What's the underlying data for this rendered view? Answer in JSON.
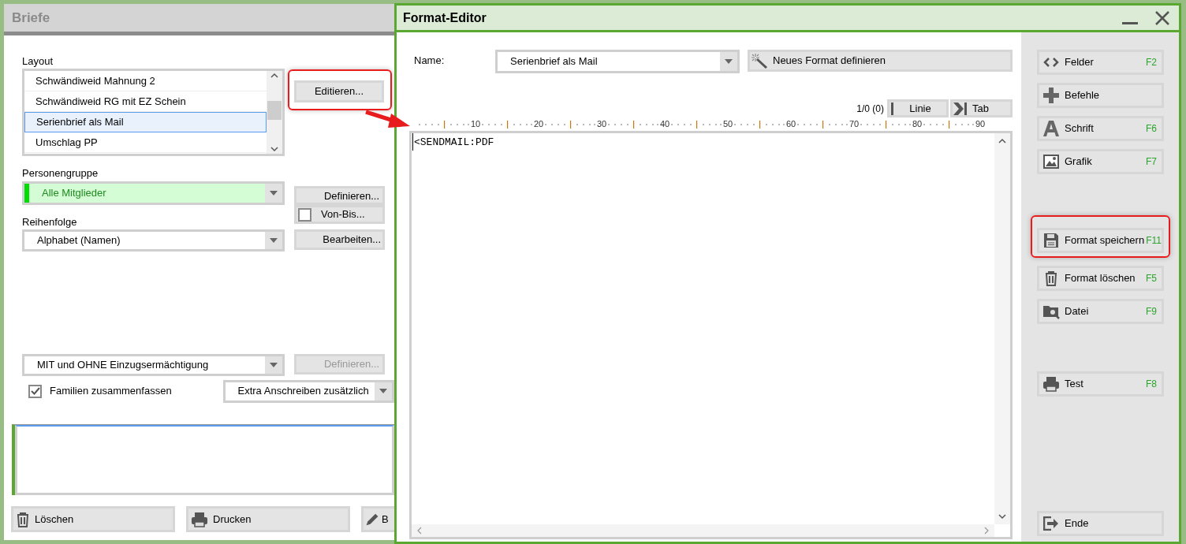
{
  "letters_window": {
    "title": "Briefe",
    "layout_label": "Layout",
    "layout_list": [
      {
        "label": "Schwändiweid Mahnung 2",
        "selected": false
      },
      {
        "label": "Schwändiweid RG mit EZ Schein",
        "selected": false
      },
      {
        "label": "Serienbrief als Mail",
        "selected": true
      },
      {
        "label": "Umschlag PP",
        "selected": false
      }
    ],
    "edit_button": {
      "label": "Editieren...",
      "highlighted": true
    },
    "group_label": "Personengruppe",
    "group_combo": "Alle Mitglieder",
    "define_button": {
      "label": "Definieren...",
      "disabled": false
    },
    "from_to": {
      "label": "Von-Bis...",
      "checked": false
    },
    "order_label": "Reihenfolge",
    "order_combo": "Alphabet (Namen)",
    "process_button": {
      "label": "Bearbeiten...",
      "disabled": false
    },
    "mandate_combo": "MIT und OHNE Einzugsermächtigung",
    "define2_button": {
      "label": "Definieren...",
      "disabled": true
    },
    "families": {
      "label": "Familien zusammenfassen",
      "checked": true
    },
    "extra_combo": "Extra Anschreiben zusätzlich",
    "bottom_buttons": [
      {
        "label": "Löschen",
        "kind": "trash"
      },
      {
        "label": "Drucken",
        "kind": "printer"
      },
      {
        "label": "B",
        "kind": "pencil"
      }
    ]
  },
  "format_editor": {
    "title": "Format-Editor",
    "name_label": "Name:",
    "name_combo": "Serienbrief als Mail",
    "new_format_button": "Neues Format definieren",
    "position": "1/0 (0)",
    "line_button": "Linie",
    "tab_button": "Tab",
    "ruler": [
      "10",
      "20",
      "30",
      "40",
      "50",
      "60",
      "70",
      "80",
      "90"
    ],
    "content": "<SENDMAIL:PDF",
    "side_groups": [
      [
        {
          "label": "Felder",
          "key": "F2",
          "kind": "code",
          "highlighted": false
        },
        {
          "label": "Befehle",
          "kind": "plus",
          "highlighted": false
        },
        {
          "label": "Schrift",
          "key": "F6",
          "kind": "font",
          "highlighted": false
        },
        {
          "label": "Grafik",
          "key": "F7",
          "kind": "image",
          "highlighted": false
        }
      ],
      [
        {
          "label": "Format speichern",
          "key": "F11",
          "kind": "save",
          "highlighted": true
        },
        {
          "label": "Format löschen",
          "key": "F5",
          "kind": "trash",
          "highlighted": false
        },
        {
          "label": "Datei",
          "key": "F9",
          "kind": "folder",
          "highlighted": false
        }
      ],
      [
        {
          "label": "Test",
          "key": "F8",
          "kind": "printer",
          "highlighted": false
        }
      ],
      [
        {
          "label": "Ende",
          "kind": "exit",
          "highlighted": false
        }
      ]
    ]
  }
}
